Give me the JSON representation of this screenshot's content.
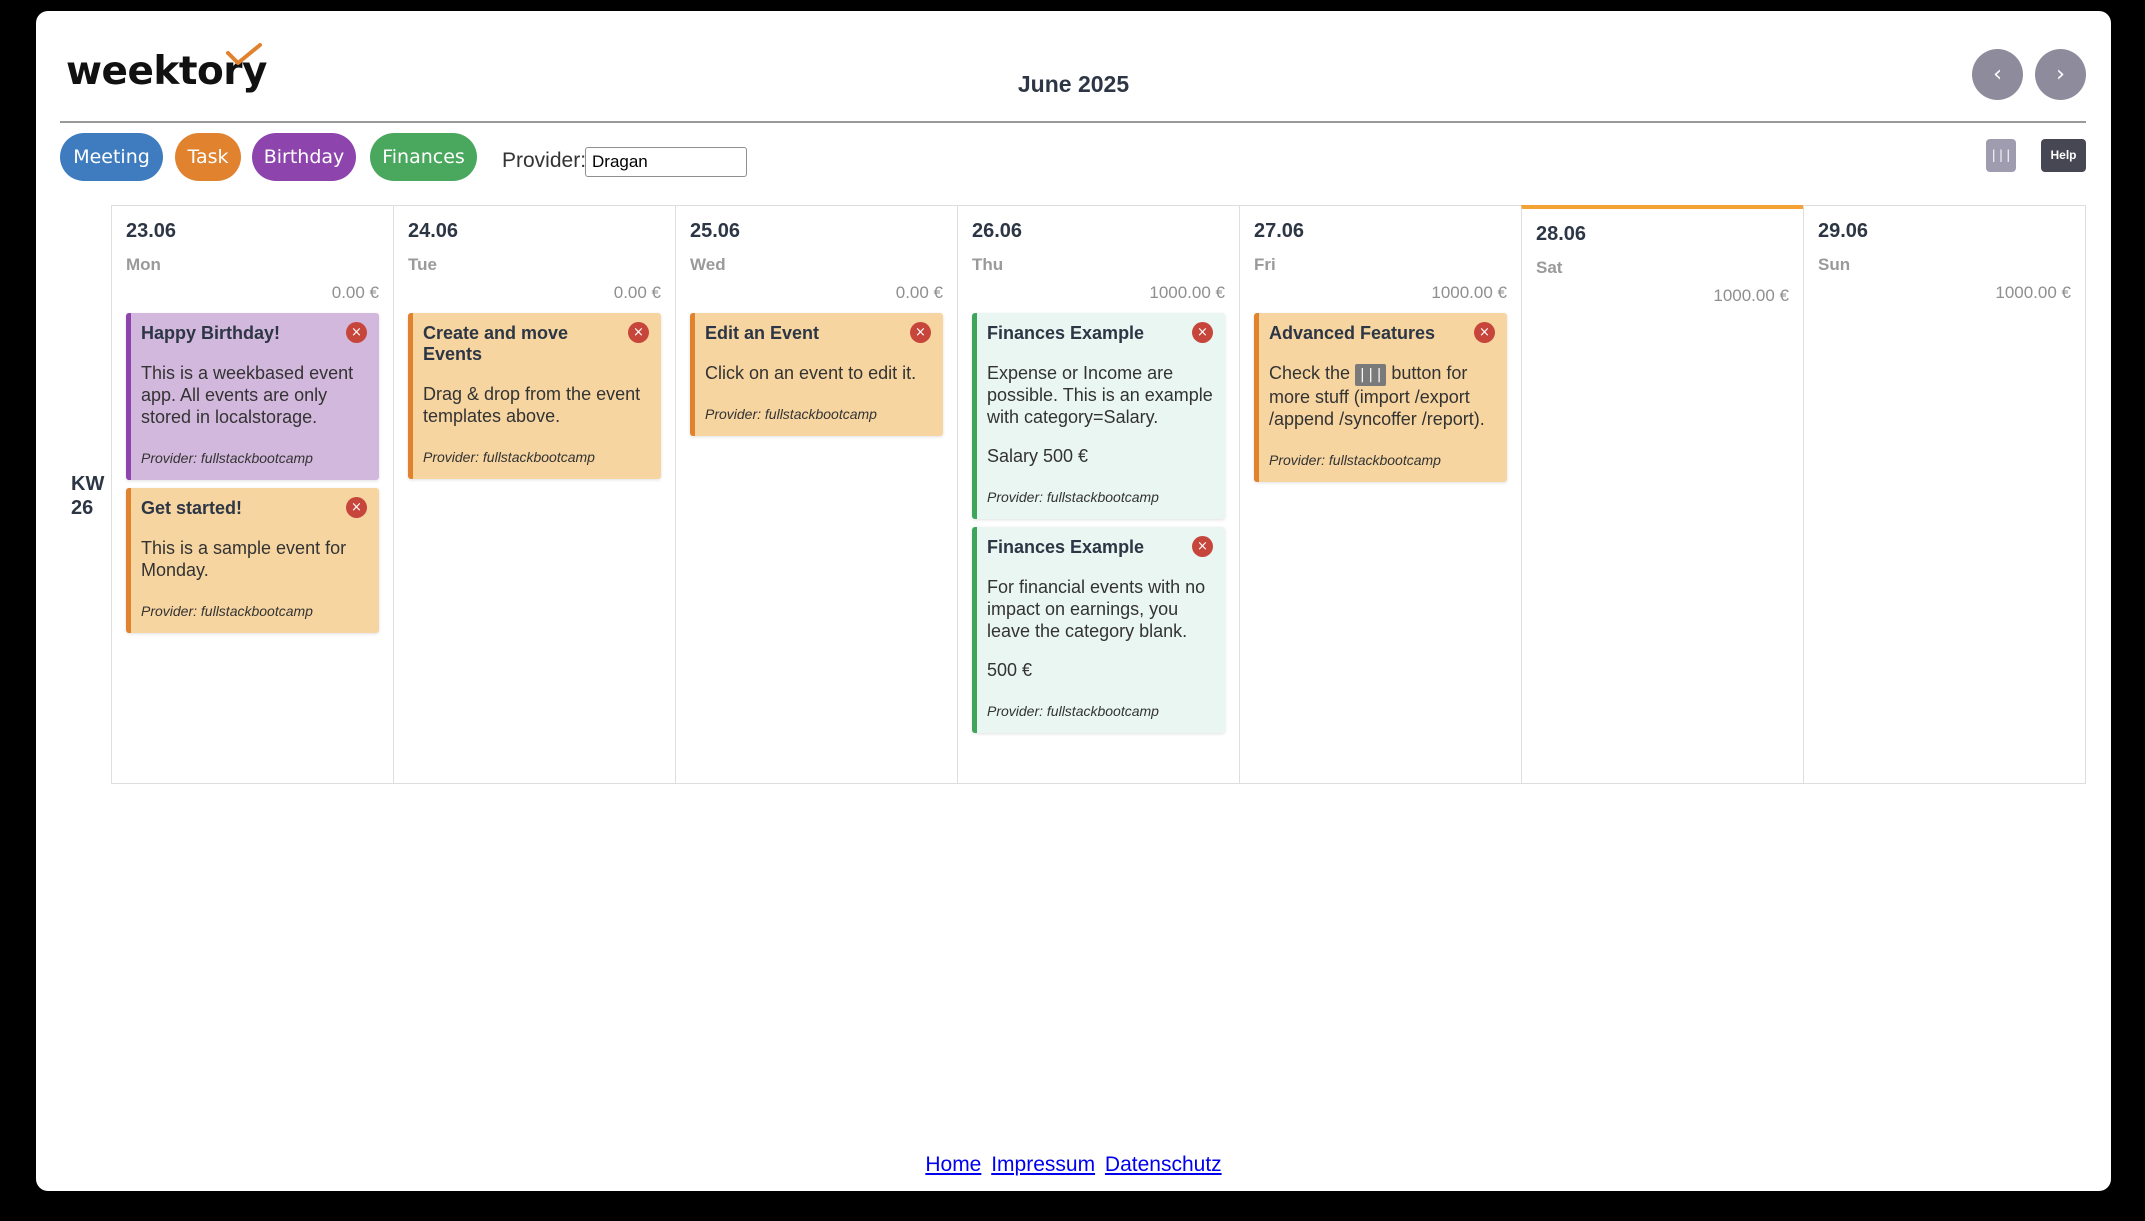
{
  "header": {
    "logo": "weektory",
    "month": "June 2025",
    "prev_label": "‹",
    "next_label": "›"
  },
  "templates": [
    {
      "label": "Meeting",
      "color": "#3f7cbf"
    },
    {
      "label": "Task",
      "color": "#e0822e"
    },
    {
      "label": "Birthday",
      "color": "#8d45ad"
    },
    {
      "label": "Finances",
      "color": "#4aa85e"
    }
  ],
  "provider": {
    "label": "Provider:",
    "value": "Dragan"
  },
  "toolbar": {
    "menu_label": "|||",
    "help_label": "Help"
  },
  "week": {
    "label": "KW",
    "number": "26"
  },
  "days": [
    {
      "date": "23.06",
      "name": "Mon",
      "total": "0.00 €",
      "events": [
        {
          "title": "Happy Birthday!",
          "desc": "This is a weekbased event app. All events are only stored in localstorage.",
          "provider": "Provider: fullstackbootcamp"
        },
        {
          "title": "Get started!",
          "desc": "This is a sample event for Monday.",
          "provider": "Provider: fullstackbootcamp"
        }
      ]
    },
    {
      "date": "24.06",
      "name": "Tue",
      "total": "0.00 €",
      "events": [
        {
          "title": "Create and move Events",
          "desc": "Drag & drop from the event templates above.",
          "provider": "Provider: fullstackbootcamp"
        }
      ]
    },
    {
      "date": "25.06",
      "name": "Wed",
      "total": "0.00 €",
      "events": [
        {
          "title": "Edit an Event",
          "desc": "Click on an event to edit it.",
          "provider": "Provider: fullstackbootcamp"
        }
      ]
    },
    {
      "date": "26.06",
      "name": "Thu",
      "total": "1000.00 €",
      "events": [
        {
          "title": "Finances Example",
          "desc": "Expense or Income are possible. This is an example with category=Salary.",
          "amount": "Salary 500 €",
          "provider": "Provider: fullstackbootcamp"
        },
        {
          "title": "Finances Example",
          "desc": "For financial events with no impact on earnings, you leave the category blank.",
          "amount": "500 €",
          "provider": "Provider: fullstackbootcamp"
        }
      ]
    },
    {
      "date": "27.06",
      "name": "Fri",
      "total": "1000.00 €",
      "events": [
        {
          "title": "Advanced Features",
          "desc_pre": "Check the",
          "desc_icon": "|||",
          "desc_post": "button for more stuff (import /export /append /syncoffer /report).",
          "provider": "Provider: fullstackbootcamp"
        }
      ]
    },
    {
      "date": "28.06",
      "name": "Sat",
      "total": "1000.00 €",
      "events": []
    },
    {
      "date": "29.06",
      "name": "Sun",
      "total": "1000.00 €",
      "events": []
    }
  ],
  "event_close_label": "×",
  "footer": {
    "links": [
      "Home",
      "Impressum",
      "Datenschutz"
    ]
  }
}
